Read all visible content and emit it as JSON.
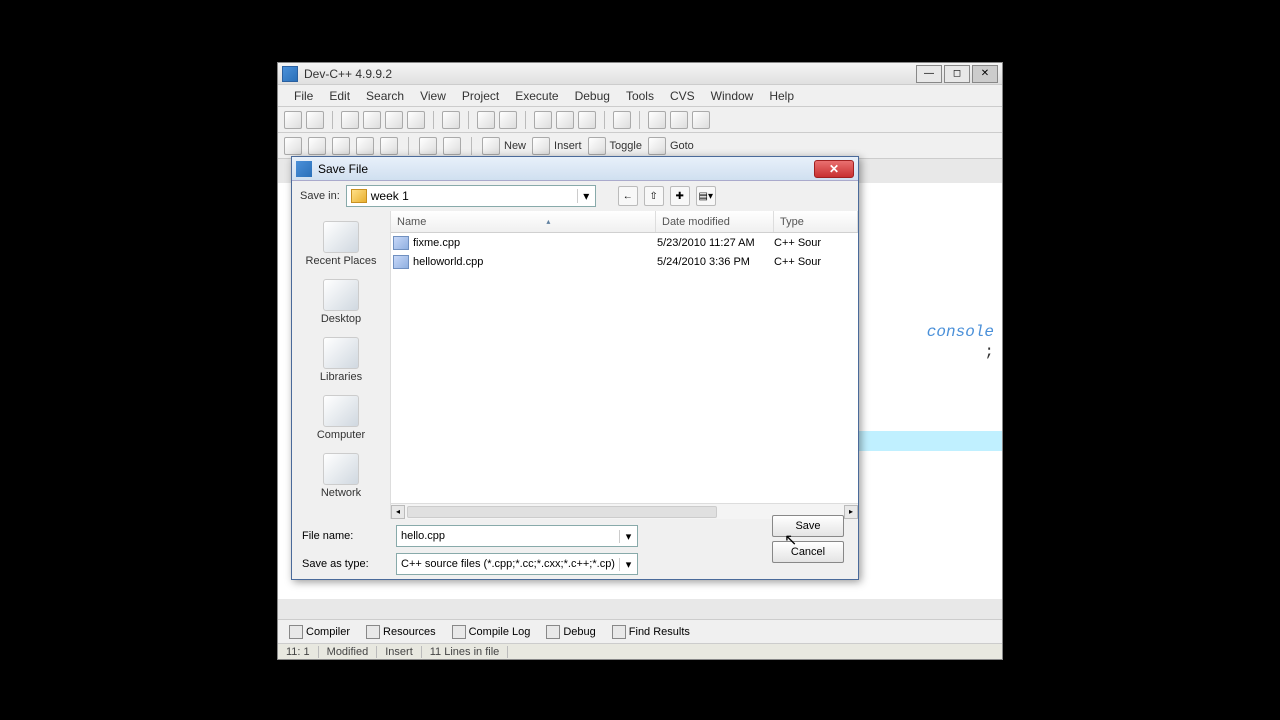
{
  "main": {
    "title": "Dev-C++ 4.9.9.2",
    "menu": [
      "File",
      "Edit",
      "Search",
      "View",
      "Project",
      "Execute",
      "Debug",
      "Tools",
      "CVS",
      "Window",
      "Help"
    ],
    "toolbar2_labels": {
      "new": "New",
      "insert": "Insert",
      "toggle": "Toggle",
      "goto": "Goto"
    },
    "editor_token": "console",
    "bottom_tabs": [
      "Compiler",
      "Resources",
      "Compile Log",
      "Debug",
      "Find Results"
    ],
    "status": {
      "pos": "11: 1",
      "modified": "Modified",
      "mode": "Insert",
      "lines": "11 Lines in file"
    }
  },
  "dialog": {
    "title": "Save File",
    "savein_label": "Save in:",
    "savein_value": "week 1",
    "places": [
      "Recent Places",
      "Desktop",
      "Libraries",
      "Computer",
      "Network"
    ],
    "columns": {
      "name": "Name",
      "date": "Date modified",
      "type": "Type"
    },
    "files": [
      {
        "name": "fixme.cpp",
        "date": "5/23/2010 11:27 AM",
        "type": "C++ Sour"
      },
      {
        "name": "helloworld.cpp",
        "date": "5/24/2010 3:36 PM",
        "type": "C++ Sour"
      }
    ],
    "filename_label": "File name:",
    "filename_value": "hello.cpp",
    "saveastype_label": "Save as type:",
    "saveastype_value": "C++ source files (*.cpp;*.cc;*.cxx;*.c++;*.cp)",
    "save_btn": "Save",
    "cancel_btn": "Cancel"
  }
}
